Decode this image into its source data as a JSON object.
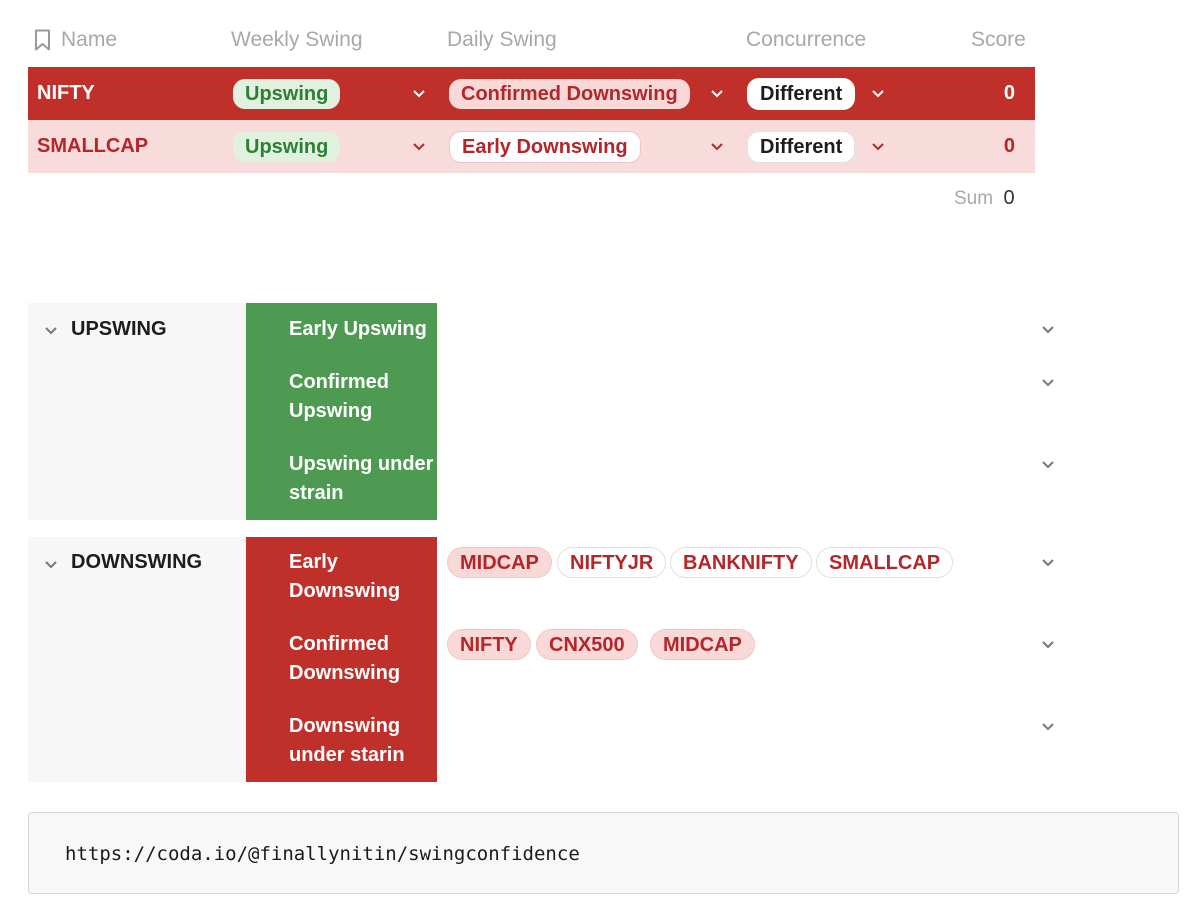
{
  "table": {
    "headers": {
      "name": "Name",
      "weekly": "Weekly Swing",
      "daily": "Daily Swing",
      "concurrence": "Concurrence",
      "score": "Score"
    },
    "rows": [
      {
        "name": "NIFTY",
        "weekly": "Upswing",
        "daily": "Confirmed Downswing",
        "concurrence": "Different",
        "score": "0"
      },
      {
        "name": "SMALLCAP",
        "weekly": "Upswing",
        "daily": "Early Downswing",
        "concurrence": "Different",
        "score": "0"
      }
    ],
    "sum_label": "Sum",
    "sum_value": "0"
  },
  "groups": [
    {
      "title": "UPSWING",
      "stages": [
        {
          "label": "Early Upswing",
          "tags": []
        },
        {
          "label": "Confirmed Upswing",
          "tags": []
        },
        {
          "label": "Upswing under strain",
          "tags": []
        }
      ]
    },
    {
      "title": "DOWNSWING",
      "stages": [
        {
          "label": "Early Downswing",
          "tags": [
            "MIDCAP",
            "NIFTYJR",
            "BANKNIFTY",
            "SMALLCAP"
          ]
        },
        {
          "label": "Confirmed Downswing",
          "tags": [
            "NIFTY",
            "CNX500",
            "MIDCAP"
          ]
        },
        {
          "label": "Downswing under starin",
          "tags": []
        }
      ]
    }
  ],
  "footer": {
    "url": "https://coda.io/@finallynitin/swingconfidence"
  },
  "icons": {
    "name_header": "bookmark-icon",
    "dropdown": "chevron-down-icon",
    "group_toggle": "chevron-down-icon"
  },
  "colors": {
    "red": "#c0302a",
    "pink_row": "#f8dcdc",
    "green": "#4f9a53",
    "tag_text": "#b3262a",
    "upswing_text": "#2e7f35"
  }
}
